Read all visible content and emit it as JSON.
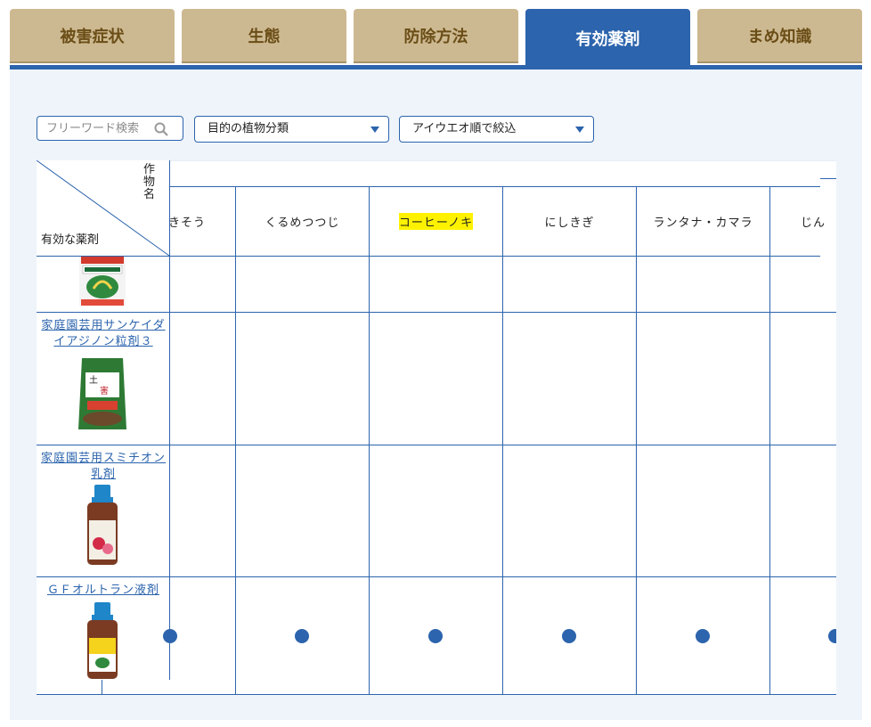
{
  "tabs": [
    {
      "label": "被害症状",
      "active": false
    },
    {
      "label": "生態",
      "active": false
    },
    {
      "label": "防除方法",
      "active": false
    },
    {
      "label": "有効薬剤",
      "active": true
    },
    {
      "label": "まめ知識",
      "active": false
    }
  ],
  "filters": {
    "search_placeholder": "フリーワード検索",
    "plant_category": "目的の植物分類",
    "kana_filter": "アイウエオ順で絞込"
  },
  "table": {
    "corner_top": "作物名",
    "corner_bottom": "有効な薬剤",
    "columns": [
      {
        "label": "きそう",
        "highlight": false
      },
      {
        "label": "くるめつつじ",
        "highlight": false
      },
      {
        "label": "コーヒーノキ",
        "highlight": true
      },
      {
        "label": "にしきぎ",
        "highlight": false
      },
      {
        "label": "ランタナ・カマラ",
        "highlight": false
      },
      {
        "label": "じん",
        "highlight": false
      }
    ],
    "rows": [
      {
        "product": "",
        "marks": [
          false,
          false,
          false,
          false,
          false,
          false
        ]
      },
      {
        "product": "家庭園芸用サンケイダイアジノン粒剤３",
        "marks": [
          false,
          false,
          false,
          false,
          false,
          false
        ]
      },
      {
        "product": "家庭園芸用スミチオン乳剤",
        "marks": [
          false,
          false,
          false,
          false,
          false,
          false
        ]
      },
      {
        "product": "ＧＦオルトラン液剤",
        "marks": [
          true,
          true,
          true,
          true,
          true,
          true
        ]
      }
    ]
  },
  "colors": {
    "accent": "#2c64ad",
    "tab_inactive": "#cdb991",
    "highlight": "#fff200"
  }
}
